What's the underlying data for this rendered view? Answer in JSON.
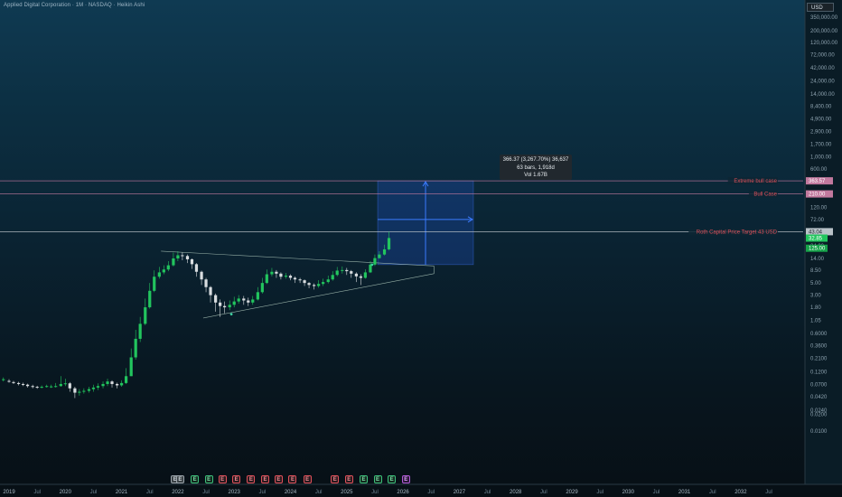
{
  "header": {
    "title": "Applied Digital Corporation · 1M · NASDAQ · Heikin Ashi",
    "currency": "USD"
  },
  "chart_data": {
    "type": "candlestick",
    "y_scale": "log",
    "y_ticks": [
      {
        "value": 350000,
        "label": "350,000.00"
      },
      {
        "value": 200000,
        "label": "200,000.00"
      },
      {
        "value": 120000,
        "label": "120,000.00"
      },
      {
        "value": 72000,
        "label": "72,000.00"
      },
      {
        "value": 42000,
        "label": "42,000.00"
      },
      {
        "value": 24000,
        "label": "24,000.00"
      },
      {
        "value": 14000,
        "label": "14,000.00"
      },
      {
        "value": 8400,
        "label": "8,400.00"
      },
      {
        "value": 4900,
        "label": "4,900.00"
      },
      {
        "value": 2900,
        "label": "2,900.00"
      },
      {
        "value": 1700,
        "label": "1,700.00"
      },
      {
        "value": 1000,
        "label": "1,000.00"
      },
      {
        "value": 600,
        "label": "600.00"
      },
      {
        "value": 350,
        "label": "350.00"
      },
      {
        "value": 120,
        "label": "120.00"
      },
      {
        "value": 72,
        "label": "72.00"
      },
      {
        "value": 42,
        "label": "42.00"
      },
      {
        "value": 24,
        "label": "24.00"
      },
      {
        "value": 14,
        "label": "14.00"
      },
      {
        "value": 8.5,
        "label": "8.50"
      },
      {
        "value": 5,
        "label": "5.00"
      },
      {
        "value": 3,
        "label": "3.00"
      },
      {
        "value": 1.8,
        "label": "1.80"
      },
      {
        "value": 1.05,
        "label": "1.05"
      },
      {
        "value": 0.6,
        "label": "0.6000"
      },
      {
        "value": 0.36,
        "label": "0.3600"
      },
      {
        "value": 0.21,
        "label": "0.2100"
      },
      {
        "value": 0.12,
        "label": "0.1200"
      },
      {
        "value": 0.07,
        "label": "0.0700"
      },
      {
        "value": 0.042,
        "label": "0.0420"
      },
      {
        "value": 0.024,
        "label": "0.0240"
      },
      {
        "value": 0.02,
        "label": "0.0200"
      },
      {
        "value": 0.01,
        "label": "0.0100"
      }
    ],
    "x_ticks": [
      {
        "t": 2019.0,
        "label": "2019"
      },
      {
        "t": 2019.5,
        "label": "Jul"
      },
      {
        "t": 2020.0,
        "label": "2020"
      },
      {
        "t": 2020.5,
        "label": "Jul"
      },
      {
        "t": 2021.0,
        "label": "2021"
      },
      {
        "t": 2021.5,
        "label": "Jul"
      },
      {
        "t": 2022.0,
        "label": "2022"
      },
      {
        "t": 2022.5,
        "label": "Jul"
      },
      {
        "t": 2023.0,
        "label": "2023"
      },
      {
        "t": 2023.5,
        "label": "Jul"
      },
      {
        "t": 2024.0,
        "label": "2024"
      },
      {
        "t": 2024.5,
        "label": "Jul"
      },
      {
        "t": 2025.0,
        "label": "2025"
      },
      {
        "t": 2025.5,
        "label": "Jul"
      },
      {
        "t": 2026.0,
        "label": "2026"
      },
      {
        "t": 2026.5,
        "label": "Jul"
      },
      {
        "t": 2027.0,
        "label": "2027"
      },
      {
        "t": 2027.5,
        "label": "Jul"
      },
      {
        "t": 2028.0,
        "label": "2028"
      },
      {
        "t": 2028.5,
        "label": "Jul"
      },
      {
        "t": 2029.0,
        "label": "2029"
      },
      {
        "t": 2029.5,
        "label": "Jul"
      },
      {
        "t": 2030.0,
        "label": "2030"
      },
      {
        "t": 2030.5,
        "label": "Jul"
      },
      {
        "t": 2031.0,
        "label": "2031"
      },
      {
        "t": 2031.5,
        "label": "Jul"
      },
      {
        "t": 2032.0,
        "label": "2032"
      },
      {
        "t": 2032.5,
        "label": "Jul"
      }
    ],
    "candles": [
      [
        2018.9,
        0.085,
        0.088,
        0.095,
        0.08
      ],
      [
        2019.0,
        0.082,
        0.08,
        0.088,
        0.076
      ],
      [
        2019.08,
        0.078,
        0.075,
        0.082,
        0.072
      ],
      [
        2019.17,
        0.075,
        0.072,
        0.079,
        0.068
      ],
      [
        2019.25,
        0.072,
        0.07,
        0.076,
        0.066
      ],
      [
        2019.33,
        0.07,
        0.066,
        0.073,
        0.062
      ],
      [
        2019.42,
        0.066,
        0.064,
        0.07,
        0.06
      ],
      [
        2019.5,
        0.064,
        0.063,
        0.067,
        0.059
      ],
      [
        2019.58,
        0.063,
        0.064,
        0.068,
        0.06
      ],
      [
        2019.67,
        0.064,
        0.066,
        0.07,
        0.062
      ],
      [
        2019.75,
        0.065,
        0.065,
        0.07,
        0.061
      ],
      [
        2019.83,
        0.065,
        0.066,
        0.075,
        0.062
      ],
      [
        2019.92,
        0.066,
        0.072,
        0.1,
        0.064
      ],
      [
        2020.0,
        0.072,
        0.074,
        0.09,
        0.066
      ],
      [
        2020.08,
        0.074,
        0.06,
        0.078,
        0.052
      ],
      [
        2020.17,
        0.06,
        0.05,
        0.064,
        0.04
      ],
      [
        2020.25,
        0.05,
        0.052,
        0.058,
        0.044
      ],
      [
        2020.33,
        0.052,
        0.054,
        0.06,
        0.048
      ],
      [
        2020.42,
        0.054,
        0.058,
        0.064,
        0.05
      ],
      [
        2020.5,
        0.058,
        0.062,
        0.07,
        0.052
      ],
      [
        2020.58,
        0.062,
        0.066,
        0.074,
        0.056
      ],
      [
        2020.67,
        0.066,
        0.072,
        0.08,
        0.06
      ],
      [
        2020.75,
        0.072,
        0.08,
        0.09,
        0.066
      ],
      [
        2020.83,
        0.08,
        0.072,
        0.084,
        0.062
      ],
      [
        2020.92,
        0.072,
        0.068,
        0.076,
        0.06
      ],
      [
        2021.0,
        0.068,
        0.075,
        0.084,
        0.064
      ],
      [
        2021.08,
        0.075,
        0.1,
        0.14,
        0.072
      ],
      [
        2021.17,
        0.1,
        0.22,
        0.32,
        0.1
      ],
      [
        2021.25,
        0.22,
        0.48,
        0.7,
        0.2
      ],
      [
        2021.33,
        0.48,
        0.9,
        1.2,
        0.42
      ],
      [
        2021.42,
        0.9,
        1.8,
        2.6,
        0.85
      ],
      [
        2021.5,
        1.8,
        3.6,
        5.0,
        1.7
      ],
      [
        2021.58,
        3.6,
        6.5,
        8.5,
        3.4
      ],
      [
        2021.67,
        6.5,
        7.8,
        9.8,
        6.0
      ],
      [
        2021.75,
        7.8,
        8.8,
        10.5,
        7.2
      ],
      [
        2021.83,
        8.8,
        10.5,
        12.5,
        8.2
      ],
      [
        2021.92,
        10.5,
        14.0,
        18.0,
        10.0
      ],
      [
        2022.0,
        14.0,
        16.0,
        19.0,
        12.5
      ],
      [
        2022.08,
        16.0,
        15.5,
        18.0,
        13.0
      ],
      [
        2022.17,
        15.5,
        13.5,
        16.5,
        11.5
      ],
      [
        2022.25,
        13.5,
        11.0,
        14.0,
        9.0
      ],
      [
        2022.33,
        11.0,
        8.0,
        11.5,
        6.5
      ],
      [
        2022.42,
        8.0,
        5.8,
        8.4,
        4.6
      ],
      [
        2022.5,
        5.8,
        4.2,
        6.2,
        3.4
      ],
      [
        2022.58,
        4.2,
        3.0,
        4.4,
        2.2
      ],
      [
        2022.67,
        3.0,
        2.2,
        3.2,
        1.5
      ],
      [
        2022.75,
        2.2,
        1.9,
        2.5,
        1.2
      ],
      [
        2022.83,
        1.9,
        1.8,
        2.3,
        1.4
      ],
      [
        2022.92,
        1.8,
        2.0,
        2.4,
        1.6
      ],
      [
        2023.0,
        2.0,
        2.3,
        2.8,
        1.8
      ],
      [
        2023.08,
        2.3,
        2.6,
        3.0,
        2.1
      ],
      [
        2023.17,
        2.6,
        2.4,
        2.9,
        2.0
      ],
      [
        2023.25,
        2.4,
        2.2,
        2.7,
        1.9
      ],
      [
        2023.33,
        2.2,
        2.5,
        2.9,
        2.0
      ],
      [
        2023.42,
        2.5,
        3.4,
        4.2,
        2.4
      ],
      [
        2023.5,
        3.4,
        5.0,
        6.2,
        3.2
      ],
      [
        2023.58,
        5.0,
        7.2,
        8.8,
        4.8
      ],
      [
        2023.67,
        7.2,
        8.0,
        9.4,
        6.6
      ],
      [
        2023.75,
        8.0,
        7.4,
        8.6,
        6.2
      ],
      [
        2023.83,
        7.4,
        6.5,
        7.8,
        5.8
      ],
      [
        2023.92,
        6.5,
        6.8,
        7.6,
        6.0
      ],
      [
        2024.0,
        6.8,
        6.2,
        7.2,
        5.6
      ],
      [
        2024.08,
        6.2,
        5.8,
        6.6,
        5.0
      ],
      [
        2024.17,
        5.8,
        5.6,
        6.2,
        5.0
      ],
      [
        2024.25,
        5.6,
        5.0,
        5.8,
        4.4
      ],
      [
        2024.33,
        5.0,
        4.6,
        5.2,
        4.0
      ],
      [
        2024.42,
        4.6,
        4.4,
        4.9,
        3.8
      ],
      [
        2024.5,
        4.4,
        4.8,
        5.6,
        4.1
      ],
      [
        2024.58,
        4.8,
        5.2,
        6.0,
        4.4
      ],
      [
        2024.67,
        5.2,
        5.8,
        6.8,
        4.9
      ],
      [
        2024.75,
        5.8,
        7.0,
        8.2,
        5.5
      ],
      [
        2024.83,
        7.0,
        8.4,
        9.8,
        6.6
      ],
      [
        2024.92,
        8.4,
        8.6,
        10.0,
        7.4
      ],
      [
        2025.0,
        8.6,
        8.2,
        9.4,
        7.0
      ],
      [
        2025.08,
        8.2,
        7.4,
        8.6,
        6.2
      ],
      [
        2025.17,
        7.4,
        6.6,
        7.8,
        5.2
      ],
      [
        2025.25,
        6.6,
        6.2,
        7.2,
        4.6
      ],
      [
        2025.33,
        6.2,
        7.8,
        8.9,
        6.0
      ],
      [
        2025.42,
        7.8,
        10.8,
        12.5,
        7.6
      ],
      [
        2025.5,
        10.8,
        14.2,
        16.5,
        10.2
      ],
      [
        2025.58,
        14.2,
        16.5,
        19.0,
        13.8
      ],
      [
        2025.67,
        16.5,
        20.5,
        25.0,
        15.8
      ],
      [
        2025.75,
        20.5,
        33.0,
        43.0,
        19.5
      ]
    ],
    "horizontal_lines": [
      {
        "value": 363.57,
        "label": "Extreme bull case",
        "tag": "363.57",
        "color": "#c2799e"
      },
      {
        "value": 210.0,
        "label": "Bull Case",
        "tag": "210.00",
        "color": "#c2799e"
      },
      {
        "value": 43.04,
        "label": "Roth Capital Price Target 43 USD",
        "tag": "43.04",
        "color": "#c9cfd3"
      }
    ],
    "price_tags": [
      {
        "value": 32.85,
        "tag": "32.85",
        "color": "#22c55e"
      },
      {
        "value": 25.0,
        "tag": "125.00",
        "color": "#16a34a"
      }
    ],
    "trendlines": [
      {
        "t1": 2021.7,
        "v1": 19.0,
        "t2": 2026.55,
        "v2": 10.2
      },
      {
        "t1": 2022.45,
        "v1": 1.15,
        "t2": 2026.55,
        "v2": 7.4
      }
    ],
    "markers": [
      {
        "t": 2022.95,
        "value": 1.35
      },
      {
        "t": 2025.45,
        "value": 10.8
      }
    ],
    "measure": {
      "t_start": 2025.55,
      "t_end": 2027.25,
      "v_low": 10.8,
      "v_high": 363.57,
      "arrow_level": 72,
      "line1": "366.37 (3,267.70%) 36,637",
      "line2": "63 bars, 1,918d",
      "line3": "Vol 1.67B"
    },
    "events": [
      {
        "t": 2021.95,
        "letter": "E",
        "kind": "e-gray"
      },
      {
        "t": 2022.04,
        "letter": "E",
        "kind": "e-gray"
      },
      {
        "t": 2022.3,
        "letter": "E",
        "kind": "e-green"
      },
      {
        "t": 2022.55,
        "letter": "E",
        "kind": "e-green"
      },
      {
        "t": 2022.79,
        "letter": "E",
        "kind": "e-red"
      },
      {
        "t": 2023.04,
        "letter": "E",
        "kind": "e-red"
      },
      {
        "t": 2023.3,
        "letter": "E",
        "kind": "e-red"
      },
      {
        "t": 2023.55,
        "letter": "E",
        "kind": "e-red"
      },
      {
        "t": 2023.79,
        "letter": "E",
        "kind": "e-red"
      },
      {
        "t": 2024.04,
        "letter": "E",
        "kind": "e-red"
      },
      {
        "t": 2024.3,
        "letter": "E",
        "kind": "e-red"
      },
      {
        "t": 2024.79,
        "letter": "E",
        "kind": "e-red"
      },
      {
        "t": 2025.04,
        "letter": "E",
        "kind": "e-red"
      },
      {
        "t": 2025.3,
        "letter": "E",
        "kind": "e-green"
      },
      {
        "t": 2025.55,
        "letter": "E",
        "kind": "e-green"
      },
      {
        "t": 2025.8,
        "letter": "E",
        "kind": "e-green"
      },
      {
        "t": 2026.05,
        "letter": "E",
        "kind": "e-purple"
      }
    ]
  }
}
